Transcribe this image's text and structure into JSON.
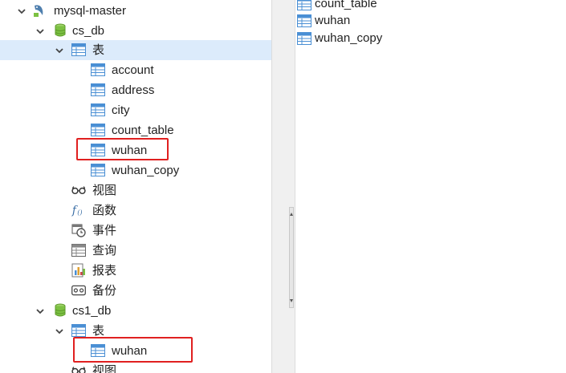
{
  "tree": {
    "connection": {
      "label": "mysql-master",
      "icon": "mysql-connection-icon"
    },
    "db1": {
      "label": "cs_db",
      "tables_label": "表",
      "tables": [
        "account",
        "address",
        "city",
        "count_table",
        "wuhan",
        "wuhan_copy"
      ],
      "highlighted_table": "wuhan",
      "views_label": "视图",
      "functions_label": "函数",
      "events_label": "事件",
      "queries_label": "查询",
      "reports_label": "报表",
      "backups_label": "备份"
    },
    "db2": {
      "label": "cs1_db",
      "tables_label": "表",
      "tables": [
        "wuhan"
      ],
      "highlighted_table": "wuhan",
      "views_label": "视图"
    }
  },
  "right_pane": {
    "items": [
      "count_table",
      "wuhan",
      "wuhan_copy"
    ]
  },
  "colors": {
    "selection": "#dcebfb",
    "highlight_box": "#e02020",
    "db_icon": "#7cc142",
    "table_icon": "#4a8fd4"
  }
}
